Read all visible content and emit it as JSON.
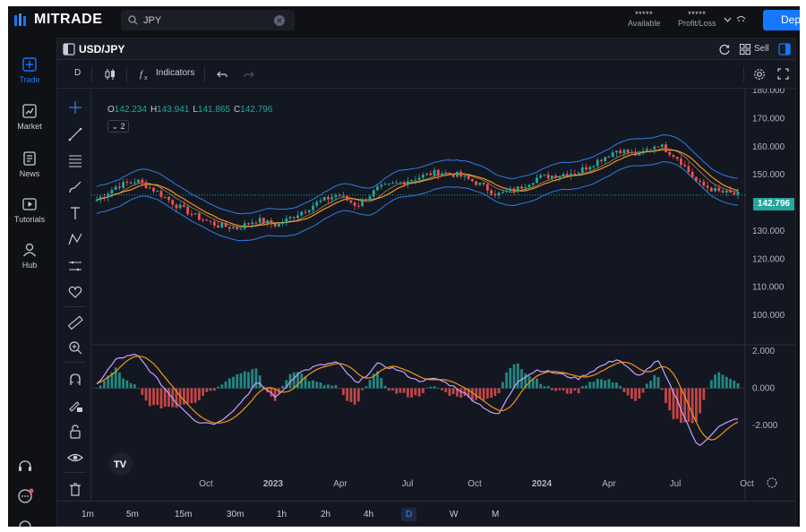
{
  "app": {
    "brand": "MITRADE"
  },
  "search": {
    "value": "JPY"
  },
  "account": {
    "available_value": "*****",
    "available_label": "Available",
    "pl_value": "*****",
    "pl_label": "Profit/Loss",
    "deposit_label": "Depo"
  },
  "nav": [
    {
      "label": "Trade",
      "icon": "trade-icon",
      "active": true
    },
    {
      "label": "Market",
      "icon": "market-icon"
    },
    {
      "label": "News",
      "icon": "news-icon"
    },
    {
      "label": "Tutorials",
      "icon": "tutorials-icon"
    },
    {
      "label": "Hub",
      "icon": "hub-icon"
    }
  ],
  "chart_header": {
    "symbol": "USD/JPY",
    "sell_label": "Sell"
  },
  "toolbar": {
    "interval": "D",
    "indicators_label": "Indicators"
  },
  "ohlc": {
    "o_label": "O",
    "o": "142.234",
    "h_label": "H",
    "h": "143.941",
    "l_label": "L",
    "l": "141.865",
    "c_label": "C",
    "c": "142.796"
  },
  "indicator_toggle": "2",
  "timeframes": [
    "1m",
    "5m",
    "15m",
    "30m",
    "1h",
    "2h",
    "4h",
    "D",
    "W",
    "M"
  ],
  "active_timeframe": "D",
  "colors": {
    "up": "#26a69a",
    "down": "#ef5350",
    "band": "#2f7de1",
    "ma": "#f7931a",
    "macd": "#c9a0ff",
    "signal": "#f7931a"
  },
  "chart_data": {
    "type": "line",
    "symbol": "USD/JPY",
    "price_axis": {
      "ticks": [
        "180.000",
        "170.000",
        "160.000",
        "150.000",
        "140.000",
        "130.000",
        "120.000",
        "110.000",
        "100.000"
      ],
      "ylim": [
        93,
        181
      ]
    },
    "last_price": "142.796",
    "x_ticks": [
      "Oct",
      "2023",
      "Apr",
      "Jul",
      "Oct",
      "2024",
      "Apr",
      "Jul",
      "Oct"
    ],
    "series": [
      {
        "name": "close",
        "values": [
          141,
          146,
          148,
          144,
          139,
          135,
          132,
          131,
          134,
          132,
          136,
          140,
          143,
          139,
          145,
          147,
          149,
          151,
          150,
          147,
          143,
          145,
          149,
          150,
          151,
          155,
          159,
          157,
          161,
          156,
          147,
          144,
          142.8
        ]
      }
    ],
    "macd_axis": {
      "ticks": [
        "2.000",
        "0.000",
        "-2.000"
      ],
      "ylim": [
        -3.5,
        2.6
      ]
    },
    "macd": [
      0.2,
      1.6,
      1.8,
      0.5,
      -0.8,
      -1.8,
      -1.9,
      -1.0,
      0.3,
      -0.5,
      0.8,
      1.2,
      1.4,
      0.2,
      1.3,
      1.0,
      0.4,
      0.5,
      0.0,
      -0.8,
      -1.5,
      0.4,
      1.0,
      0.8,
      0.5,
      1.1,
      1.6,
      0.6,
      1.5,
      -0.7,
      -3.2,
      -2.1,
      -1.6
    ]
  }
}
